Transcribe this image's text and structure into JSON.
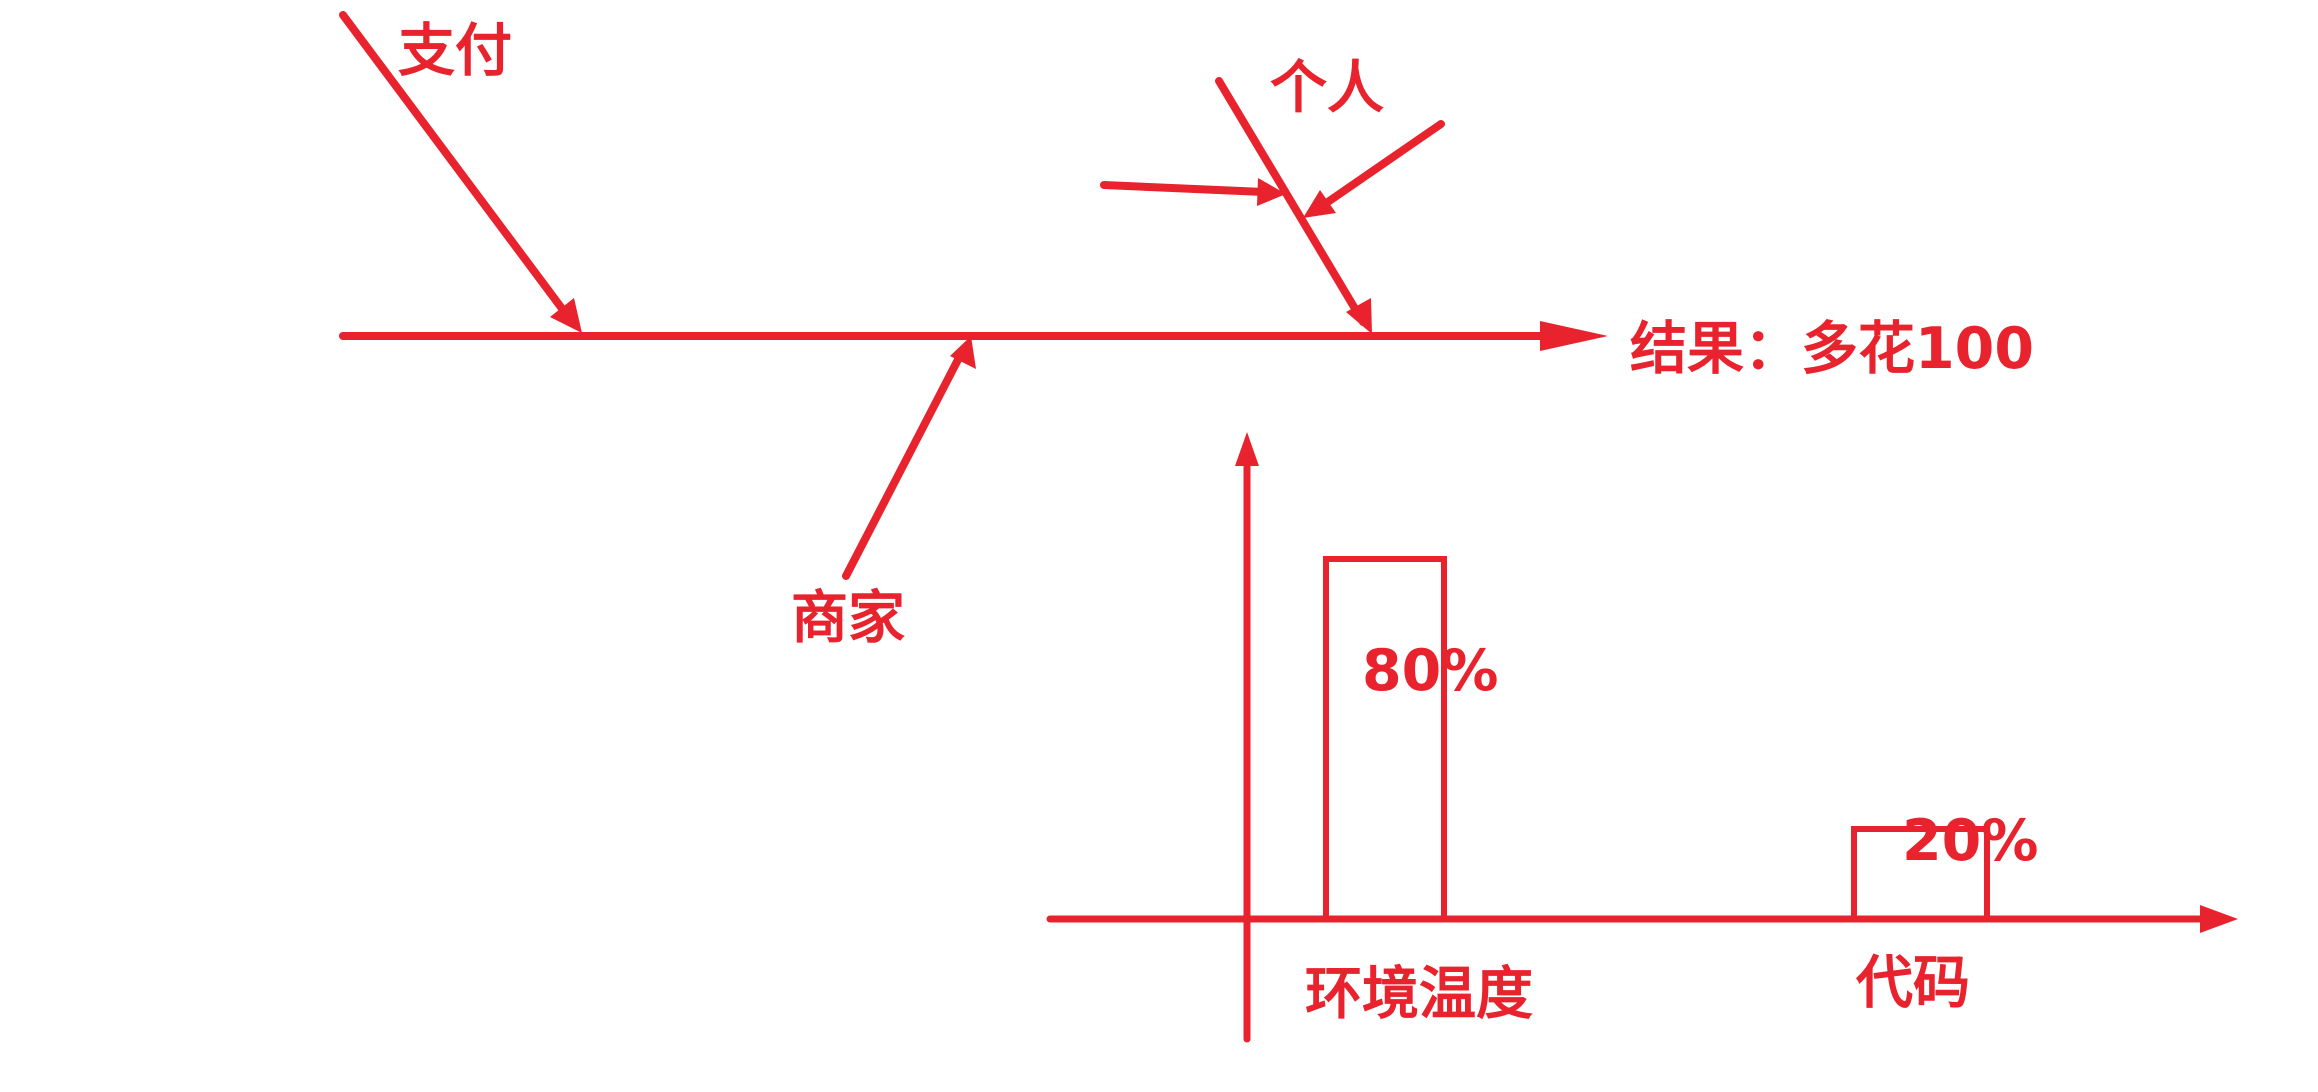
{
  "colors": {
    "ink": "#e8232d",
    "background": "#ffffff"
  },
  "fishbone": {
    "result_label": "结果：多花100",
    "causes": [
      {
        "label": "支付"
      },
      {
        "label": "个人"
      },
      {
        "label": "商家"
      }
    ]
  },
  "chart_data": {
    "type": "bar",
    "categories": [
      "环境温度",
      "代码"
    ],
    "values": [
      80,
      20
    ],
    "value_labels": [
      "80%",
      "20%"
    ],
    "unit": "%",
    "ylim": [
      0,
      100
    ],
    "bar_style": "outline",
    "grid": false,
    "legend": "none",
    "title": "",
    "xlabel": "",
    "ylabel": ""
  }
}
